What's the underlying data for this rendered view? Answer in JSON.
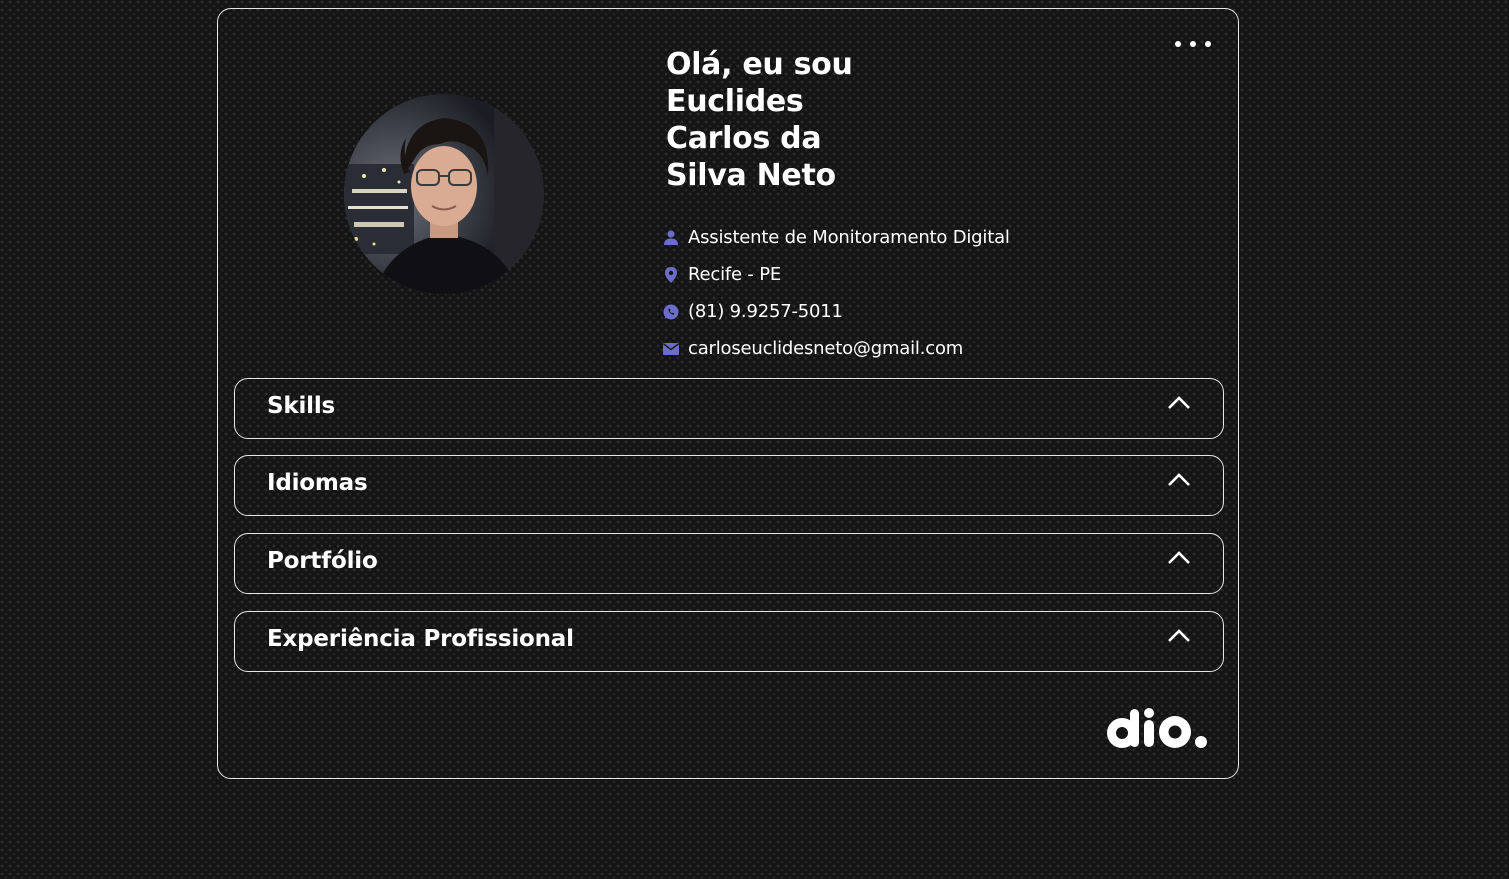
{
  "profile": {
    "greeting": "Olá, eu sou Euclides Carlos da Silva Neto",
    "photo_alt": "Foto de perfil",
    "role": "Assistente de Monitoramento Digital",
    "location": "Recife - PE",
    "phone": "(81) 9.9257-5011",
    "email": "carloseuclidesneto@gmail.com"
  },
  "sections": [
    {
      "label": "Skills"
    },
    {
      "label": "Idiomas"
    },
    {
      "label": "Portfólio"
    },
    {
      "label": "Experiência Profissional"
    }
  ],
  "icons": {
    "menu": "more-horizontal-icon",
    "role": "user-icon",
    "location": "map-pin-icon",
    "phone": "whatsapp-icon",
    "email": "mail-icon",
    "expand": "chevron-up-icon"
  },
  "colors": {
    "background": "#141414",
    "text": "#ffffff",
    "border": "#e6e6e6",
    "icon_accent": "#6a6ec9"
  }
}
